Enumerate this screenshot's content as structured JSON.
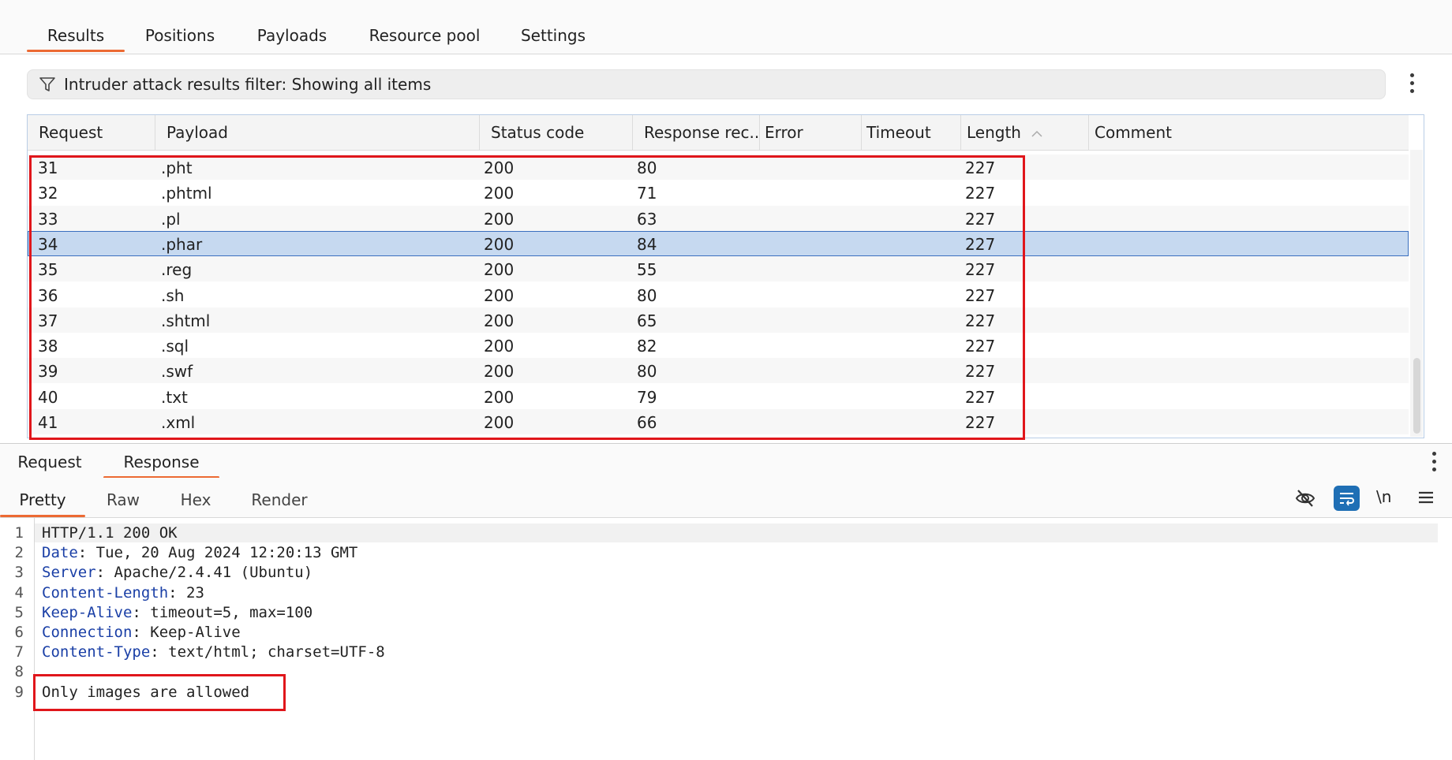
{
  "top_tabs": [
    {
      "label": "Results",
      "active": true
    },
    {
      "label": "Positions"
    },
    {
      "label": "Payloads"
    },
    {
      "label": "Resource pool"
    },
    {
      "label": "Settings"
    }
  ],
  "filter": {
    "text": "Intruder attack results filter: Showing all items"
  },
  "table": {
    "columns": [
      "Request",
      "Payload",
      "Status code",
      "Response rec...",
      "Error",
      "Timeout",
      "Length",
      "Comment"
    ],
    "sort_column": "Length",
    "rows": [
      {
        "request": "31",
        "payload": ".pht",
        "status": "200",
        "response": "80",
        "error": "",
        "timeout": "",
        "length": "227",
        "comment": ""
      },
      {
        "request": "32",
        "payload": ".phtml",
        "status": "200",
        "response": "71",
        "error": "",
        "timeout": "",
        "length": "227",
        "comment": ""
      },
      {
        "request": "33",
        "payload": ".pl",
        "status": "200",
        "response": "63",
        "error": "",
        "timeout": "",
        "length": "227",
        "comment": ""
      },
      {
        "request": "34",
        "payload": ".phar",
        "status": "200",
        "response": "84",
        "error": "",
        "timeout": "",
        "length": "227",
        "comment": "",
        "selected": true
      },
      {
        "request": "35",
        "payload": ".reg",
        "status": "200",
        "response": "55",
        "error": "",
        "timeout": "",
        "length": "227",
        "comment": ""
      },
      {
        "request": "36",
        "payload": ".sh",
        "status": "200",
        "response": "80",
        "error": "",
        "timeout": "",
        "length": "227",
        "comment": ""
      },
      {
        "request": "37",
        "payload": ".shtml",
        "status": "200",
        "response": "65",
        "error": "",
        "timeout": "",
        "length": "227",
        "comment": ""
      },
      {
        "request": "38",
        "payload": ".sql",
        "status": "200",
        "response": "82",
        "error": "",
        "timeout": "",
        "length": "227",
        "comment": ""
      },
      {
        "request": "39",
        "payload": ".swf",
        "status": "200",
        "response": "80",
        "error": "",
        "timeout": "",
        "length": "227",
        "comment": ""
      },
      {
        "request": "40",
        "payload": ".txt",
        "status": "200",
        "response": "79",
        "error": "",
        "timeout": "",
        "length": "227",
        "comment": ""
      },
      {
        "request": "41",
        "payload": ".xml",
        "status": "200",
        "response": "66",
        "error": "",
        "timeout": "",
        "length": "227",
        "comment": ""
      }
    ]
  },
  "detail_tabs": [
    {
      "label": "Request"
    },
    {
      "label": "Response",
      "active": true
    }
  ],
  "view_tabs": [
    {
      "label": "Pretty",
      "active": true
    },
    {
      "label": "Raw"
    },
    {
      "label": "Hex"
    },
    {
      "label": "Render"
    }
  ],
  "toolbar": {
    "newline_label": "\\n"
  },
  "response_lines": [
    {
      "num": "1",
      "key": "",
      "value": "HTTP/1.1 200 OK"
    },
    {
      "num": "2",
      "key": "Date",
      "value": ": Tue, 20 Aug 2024 12:20:13 GMT"
    },
    {
      "num": "3",
      "key": "Server",
      "value": ": Apache/2.4.41 (Ubuntu)"
    },
    {
      "num": "4",
      "key": "Content-Length",
      "value": ": 23"
    },
    {
      "num": "5",
      "key": "Keep-Alive",
      "value": ": timeout=5, max=100"
    },
    {
      "num": "6",
      "key": "Connection",
      "value": ": Keep-Alive"
    },
    {
      "num": "7",
      "key": "Content-Type",
      "value": ": text/html; charset=UTF-8"
    },
    {
      "num": "8",
      "key": "",
      "value": ""
    },
    {
      "num": "9",
      "key": "",
      "value": "Only images are allowed"
    }
  ],
  "colors": {
    "accent": "#ec6a33",
    "selection": "#c6d9f0",
    "highlight": "#e0161b",
    "header_key": "#1a3fa6"
  }
}
